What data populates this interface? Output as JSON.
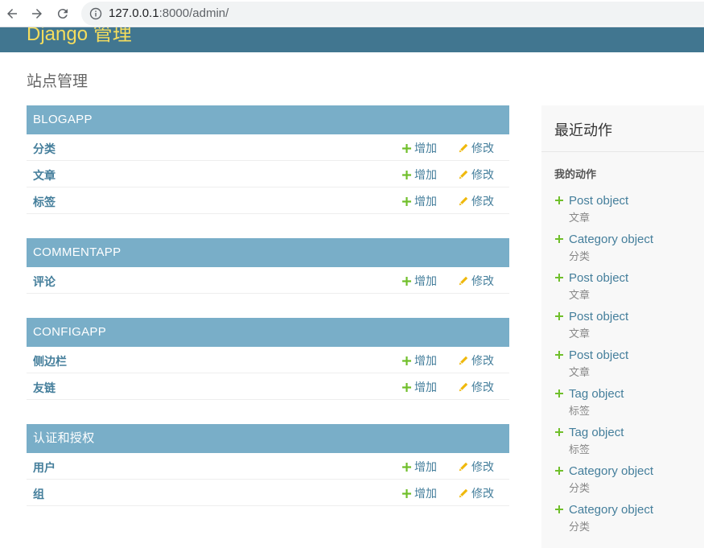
{
  "browser": {
    "url_host": "127.0.0.1",
    "url_rest": ":8000/admin/"
  },
  "header": {
    "brand": "Django 管理"
  },
  "page": {
    "title": "站点管理"
  },
  "apps": [
    {
      "name": "BLOGAPP",
      "models": [
        {
          "name": "分类",
          "add": "增加",
          "change": "修改"
        },
        {
          "name": "文章",
          "add": "增加",
          "change": "修改"
        },
        {
          "name": "标签",
          "add": "增加",
          "change": "修改"
        }
      ]
    },
    {
      "name": "COMMENTAPP",
      "models": [
        {
          "name": "评论",
          "add": "增加",
          "change": "修改"
        }
      ]
    },
    {
      "name": "CONFIGAPP",
      "models": [
        {
          "name": "侧边栏",
          "add": "增加",
          "change": "修改"
        },
        {
          "name": "友链",
          "add": "增加",
          "change": "修改"
        }
      ]
    },
    {
      "name": "认证和授权",
      "models": [
        {
          "name": "用户",
          "add": "增加",
          "change": "修改"
        },
        {
          "name": "组",
          "add": "增加",
          "change": "修改"
        }
      ]
    }
  ],
  "recent": {
    "title": "最近动作",
    "subtitle": "我的动作",
    "actions": [
      {
        "name": "Post object",
        "type": "文章"
      },
      {
        "name": "Category object",
        "type": "分类"
      },
      {
        "name": "Post object",
        "type": "文章"
      },
      {
        "name": "Post object",
        "type": "文章"
      },
      {
        "name": "Post object",
        "type": "文章"
      },
      {
        "name": "Tag object",
        "type": "标签"
      },
      {
        "name": "Tag object",
        "type": "标签"
      },
      {
        "name": "Category object",
        "type": "分类"
      },
      {
        "name": "Category object",
        "type": "分类"
      }
    ]
  },
  "colors": {
    "header_bg": "#417690",
    "brand": "#f5dd5d",
    "caption_bg": "#79aec8",
    "link": "#447e9b",
    "add_icon": "#70bf2b",
    "change_icon": "#efb80b"
  },
  "icons": {
    "back": "arrow-left-icon",
    "forward": "arrow-right-icon",
    "reload": "reload-icon",
    "info": "info-icon",
    "add": "plus-icon",
    "change": "pencil-icon"
  }
}
